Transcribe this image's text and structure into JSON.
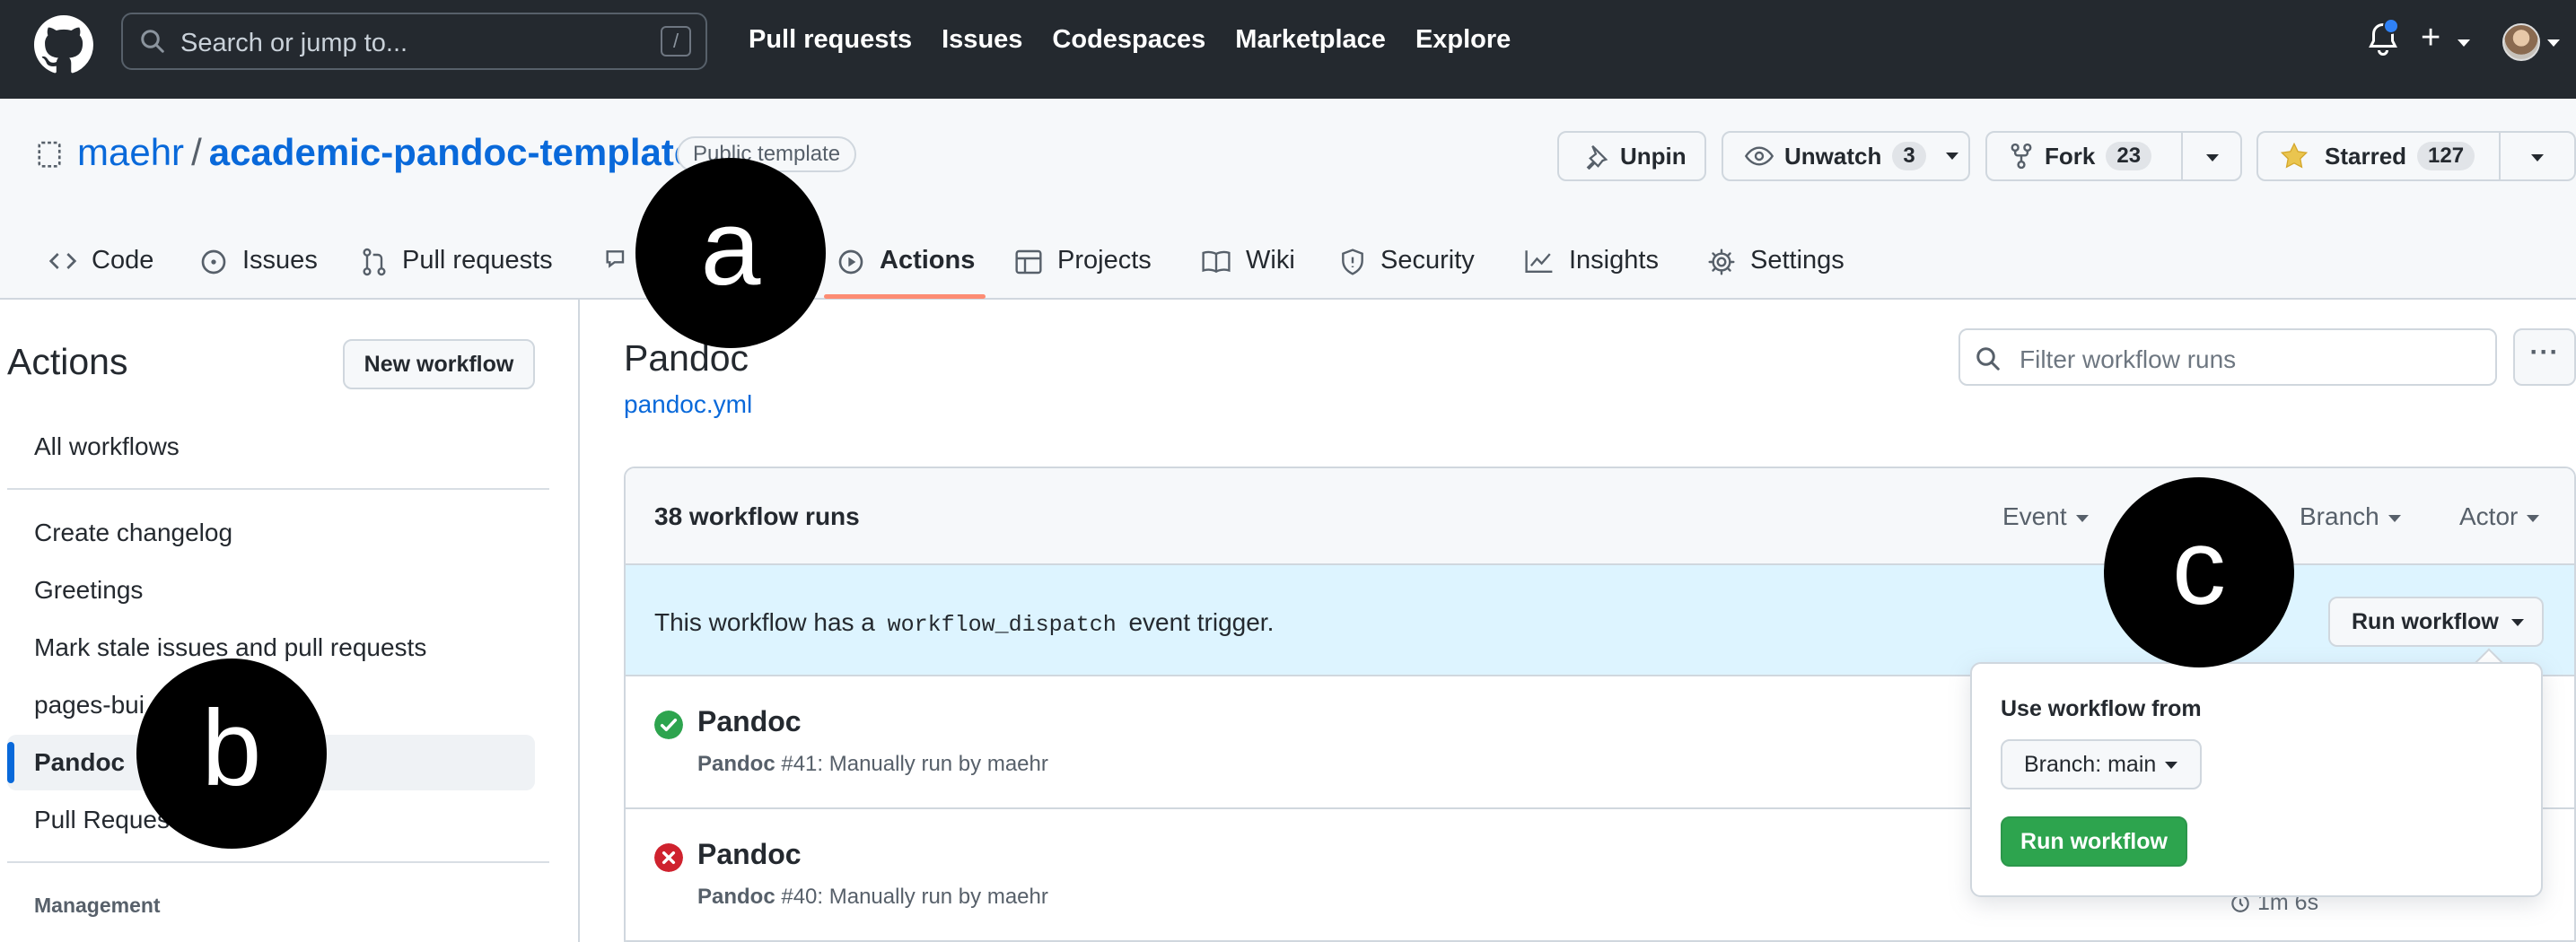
{
  "topbar": {
    "search_placeholder": "Search or jump to...",
    "search_shortcut": "/",
    "nav": [
      "Pull requests",
      "Issues",
      "Codespaces",
      "Marketplace",
      "Explore"
    ]
  },
  "repo": {
    "owner": "maehr",
    "separator": "/",
    "name": "academic-pandoc-template",
    "badge": "Public template",
    "unpin_label": "Unpin",
    "watch_label": "Unwatch",
    "watch_count": "3",
    "fork_label": "Fork",
    "fork_count": "23",
    "star_label": "Starred",
    "star_count": "127"
  },
  "tabs": [
    "Code",
    "Issues",
    "Pull requests",
    "Discussions",
    "Actions",
    "Projects",
    "Wiki",
    "Security",
    "Insights",
    "Settings"
  ],
  "tabs_visible": {
    "code": "Code",
    "issues": "Issues",
    "pulls": "Pull requests",
    "actions": "Actions",
    "projects": "Projects",
    "wiki": "Wiki",
    "security": "Security",
    "insights": "Insights",
    "settings": "Settings"
  },
  "sidebar": {
    "title": "Actions",
    "new_workflow": "New workflow",
    "all_workflows": "All workflows",
    "items": [
      "Create changelog",
      "Greetings",
      "Mark stale issues and pull requests",
      "pages-build-deployment",
      "Pandoc",
      "Pull Requests"
    ],
    "items_visible": {
      "create_changelog": "Create changelog",
      "greetings": "Greetings",
      "mark_stale": "Mark stale issues and pull requests",
      "pages_build": "pages-bui",
      "pages_build_tail": "t",
      "pandoc": "Pandoc",
      "pull_requests": "Pull Reques"
    },
    "management_heading": "Management"
  },
  "main": {
    "title": "Pandoc",
    "file_link": "pandoc.yml",
    "filter_placeholder": "Filter workflow runs",
    "kebab": "···",
    "runs_count": "38 workflow runs",
    "filters": {
      "event": "Event",
      "branch": "Branch",
      "actor": "Actor"
    },
    "dispatch_prefix": "This workflow has a",
    "dispatch_code": "workflow_dispatch",
    "dispatch_suffix": "event trigger.",
    "run_workflow_button": "Run workflow",
    "runs": [
      {
        "name": "Pandoc",
        "workflow": "Pandoc",
        "detail": "#41: Manually run by maehr",
        "status": "success"
      },
      {
        "name": "Pandoc",
        "workflow": "Pandoc",
        "detail": "#40: Manually run by maehr",
        "status": "failure",
        "duration": "1m 6s"
      }
    ]
  },
  "popover": {
    "label": "Use workflow from",
    "branch_button": "Branch: main",
    "run_button": "Run workflow"
  },
  "callouts": {
    "a": "a",
    "b": "b",
    "c": "c"
  },
  "colors": {
    "header_bg": "#24292f",
    "link": "#0969da",
    "success": "#2da44e",
    "failure": "#cf222e",
    "tab_underline": "#fd8c73",
    "dispatch_bg": "#ddf4ff"
  }
}
